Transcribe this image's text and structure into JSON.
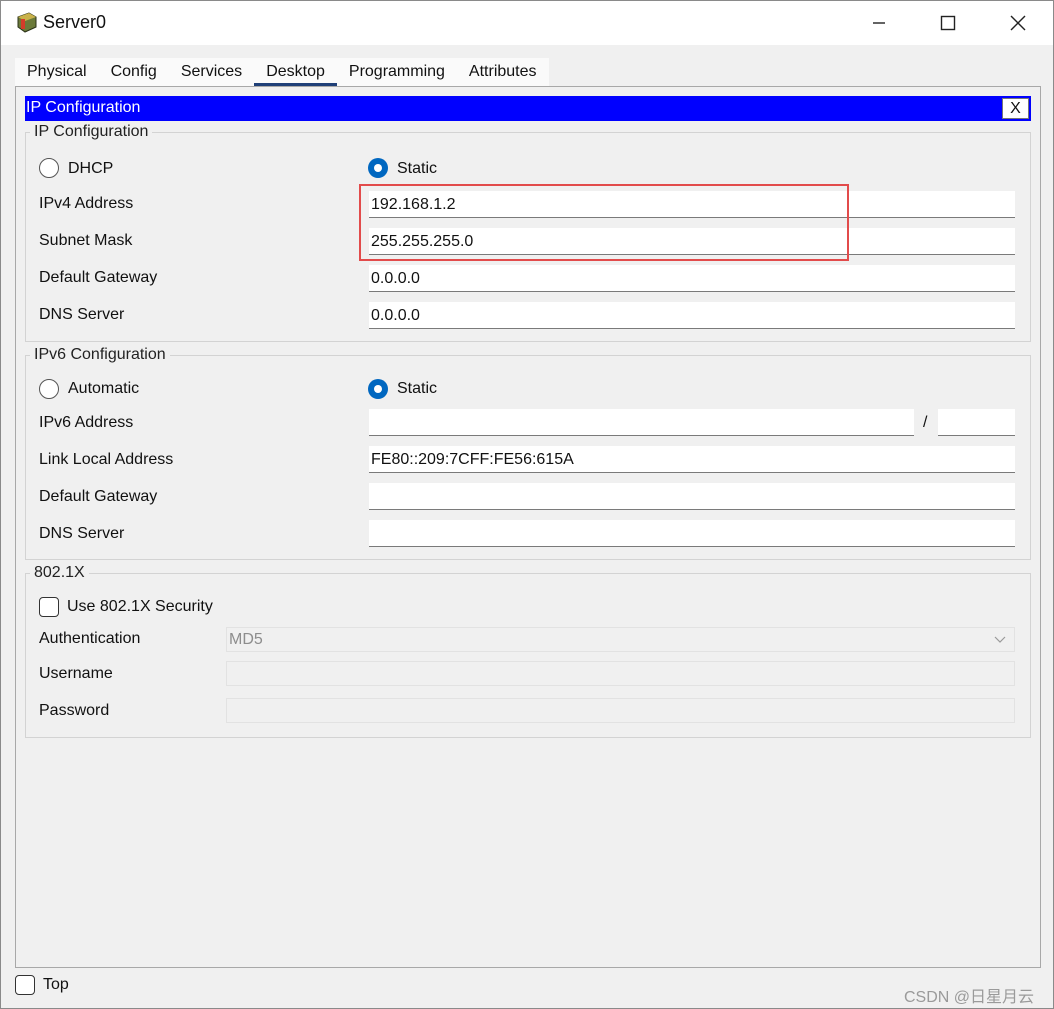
{
  "window": {
    "title": "Server0",
    "icons": {
      "app": "server-app-icon",
      "minimize": "minimize-icon",
      "maximize": "maximize-icon",
      "close": "close-icon"
    }
  },
  "tabs": [
    "Physical",
    "Config",
    "Services",
    "Desktop",
    "Programming",
    "Attributes"
  ],
  "active_tab": "Desktop",
  "panel": {
    "title": "IP Configuration",
    "close_label": "X"
  },
  "ipv4": {
    "group_title": "IP Configuration",
    "dhcp_label": "DHCP",
    "static_label": "Static",
    "mode": "Static",
    "ip_label": "IPv4 Address",
    "ip_value": "192.168.1.2",
    "mask_label": "Subnet Mask",
    "mask_value": "255.255.255.0",
    "gateway_label": "Default Gateway",
    "gateway_value": "0.0.0.0",
    "dns_label": "DNS Server",
    "dns_value": "0.0.0.0"
  },
  "ipv6": {
    "group_title": "IPv6 Configuration",
    "auto_label": "Automatic",
    "static_label": "Static",
    "mode": "Static",
    "addr_label": "IPv6 Address",
    "addr_value": "",
    "prefix_sep": "/",
    "prefix_value": "",
    "link_local_label": "Link Local Address",
    "link_local_value": "FE80::209:7CFF:FE56:615A",
    "gateway_label": "Default Gateway",
    "gateway_value": "",
    "dns_label": "DNS Server",
    "dns_value": ""
  },
  "dot1x": {
    "group_title": "802.1X",
    "use_label": "Use 802.1X Security",
    "use_checked": false,
    "auth_label": "Authentication",
    "auth_value": "MD5",
    "username_label": "Username",
    "username_value": "",
    "password_label": "Password",
    "password_value": ""
  },
  "footer": {
    "top_label": "Top",
    "top_checked": false
  },
  "watermark": "CSDN @日星月云",
  "colors": {
    "header_blue": "#0000ff",
    "radio_selected": "#0067c0",
    "highlight_red": "#e24b4b",
    "tab_underline": "#1f3f77"
  }
}
